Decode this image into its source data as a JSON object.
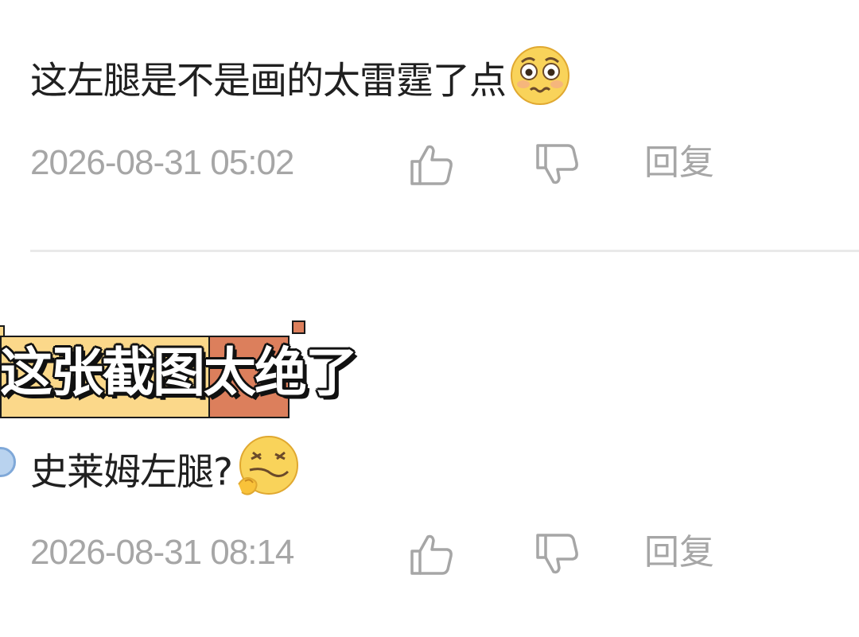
{
  "comments": [
    {
      "text": "这左腿是不是画的太雷霆了点",
      "emoji": "flushed-face-emoji",
      "timestamp": "2026-08-31 05:02",
      "reply_label": "回复"
    },
    {
      "text": "史莱姆左腿?",
      "emoji": "dizzy-laughing-face-emoji",
      "timestamp": "2026-08-31 08:14",
      "reply_label": "回复"
    }
  ],
  "overlay_caption": "这张截图太绝了",
  "icons": {
    "like": "thumbs-up-icon",
    "dislike": "thumbs-down-icon"
  },
  "colors": {
    "caption_yellow": "#fbd88a",
    "caption_orange": "#dc7f5c",
    "meta_gray": "#a6a6a6"
  }
}
